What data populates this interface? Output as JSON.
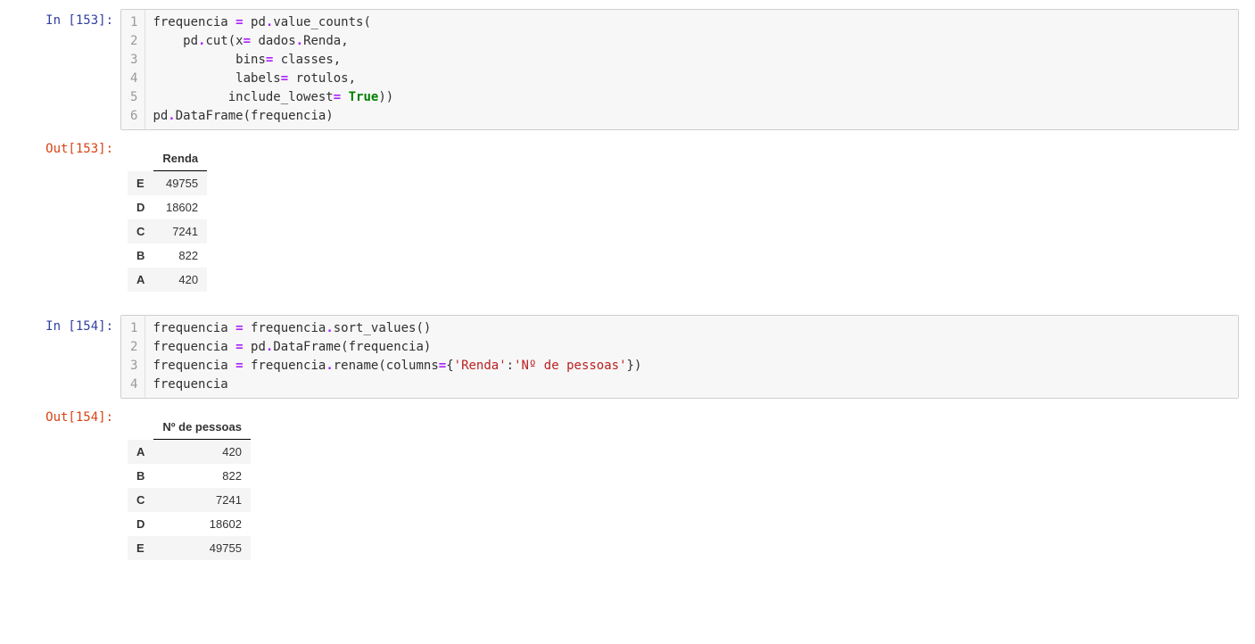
{
  "cells": [
    {
      "in_prompt": "In [153]:",
      "out_prompt": "Out[153]:",
      "gutter": [
        "1",
        "2",
        "3",
        "4",
        "5",
        "6"
      ],
      "code_tokens": [
        [
          {
            "t": "frequencia ",
            "c": "tk"
          },
          {
            "t": "=",
            "c": "tk-op"
          },
          {
            "t": " pd",
            "c": "tk"
          },
          {
            "t": ".",
            "c": "tk-op"
          },
          {
            "t": "value_counts(",
            "c": "tk"
          }
        ],
        [
          {
            "t": "    pd",
            "c": "tk"
          },
          {
            "t": ".",
            "c": "tk-op"
          },
          {
            "t": "cut(x",
            "c": "tk"
          },
          {
            "t": "=",
            "c": "tk-op"
          },
          {
            "t": " dados",
            "c": "tk"
          },
          {
            "t": ".",
            "c": "tk-op"
          },
          {
            "t": "Renda,",
            "c": "tk"
          }
        ],
        [
          {
            "t": "           bins",
            "c": "tk"
          },
          {
            "t": "=",
            "c": "tk-op"
          },
          {
            "t": " classes,",
            "c": "tk"
          }
        ],
        [
          {
            "t": "           labels",
            "c": "tk"
          },
          {
            "t": "=",
            "c": "tk-op"
          },
          {
            "t": " rotulos,",
            "c": "tk"
          }
        ],
        [
          {
            "t": "          include_lowest",
            "c": "tk"
          },
          {
            "t": "=",
            "c": "tk-op"
          },
          {
            "t": " ",
            "c": "tk"
          },
          {
            "t": "True",
            "c": "tk-kw"
          },
          {
            "t": "))",
            "c": "tk"
          }
        ],
        [
          {
            "t": "pd",
            "c": "tk"
          },
          {
            "t": ".",
            "c": "tk-op"
          },
          {
            "t": "DataFrame(frequencia)",
            "c": "tk"
          }
        ]
      ],
      "output_table": {
        "columns": [
          "Renda"
        ],
        "index": [
          "E",
          "D",
          "C",
          "B",
          "A"
        ],
        "data": [
          [
            "49755"
          ],
          [
            "18602"
          ],
          [
            "7241"
          ],
          [
            "822"
          ],
          [
            "420"
          ]
        ]
      }
    },
    {
      "in_prompt": "In [154]:",
      "out_prompt": "Out[154]:",
      "gutter": [
        "1",
        "2",
        "3",
        "4"
      ],
      "code_tokens": [
        [
          {
            "t": "frequencia ",
            "c": "tk"
          },
          {
            "t": "=",
            "c": "tk-op"
          },
          {
            "t": " frequencia",
            "c": "tk"
          },
          {
            "t": ".",
            "c": "tk-op"
          },
          {
            "t": "sort_values()",
            "c": "tk"
          }
        ],
        [
          {
            "t": "frequencia ",
            "c": "tk"
          },
          {
            "t": "=",
            "c": "tk-op"
          },
          {
            "t": " pd",
            "c": "tk"
          },
          {
            "t": ".",
            "c": "tk-op"
          },
          {
            "t": "DataFrame(frequencia)",
            "c": "tk"
          }
        ],
        [
          {
            "t": "frequencia ",
            "c": "tk"
          },
          {
            "t": "=",
            "c": "tk-op"
          },
          {
            "t": " frequencia",
            "c": "tk"
          },
          {
            "t": ".",
            "c": "tk-op"
          },
          {
            "t": "rename(columns",
            "c": "tk"
          },
          {
            "t": "=",
            "c": "tk-op"
          },
          {
            "t": "{",
            "c": "tk"
          },
          {
            "t": "'Renda'",
            "c": "tk-str"
          },
          {
            "t": ":",
            "c": "tk"
          },
          {
            "t": "'Nº de pessoas'",
            "c": "tk-str"
          },
          {
            "t": "})",
            "c": "tk"
          }
        ],
        [
          {
            "t": "frequencia",
            "c": "tk"
          }
        ]
      ],
      "output_table": {
        "columns": [
          "Nº de pessoas"
        ],
        "index": [
          "A",
          "B",
          "C",
          "D",
          "E"
        ],
        "data": [
          [
            "420"
          ],
          [
            "822"
          ],
          [
            "7241"
          ],
          [
            "18602"
          ],
          [
            "49755"
          ]
        ]
      }
    }
  ]
}
